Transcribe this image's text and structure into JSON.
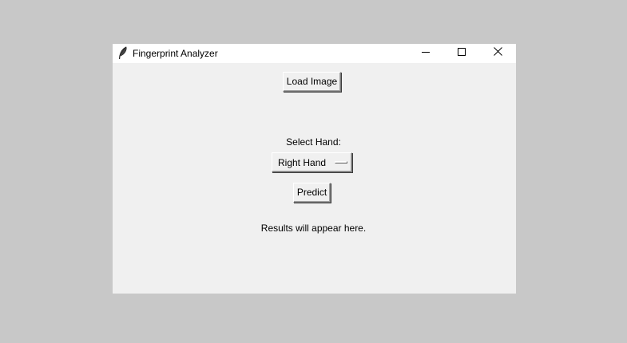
{
  "window": {
    "title": "Fingerprint Analyzer",
    "controls": [
      "minimize-icon",
      "maximize-icon",
      "close-icon"
    ]
  },
  "main": {
    "load_button_label": "Load Image",
    "hand_label": "Select Hand:",
    "hand_select": {
      "selected": "Right Hand"
    },
    "predict_button_label": "Predict",
    "results_text": "Results will appear here."
  },
  "colors": {
    "desktop": "#c8c8c8",
    "window_bg": "#f0f0f0",
    "titlebar_bg": "#ffffff"
  }
}
